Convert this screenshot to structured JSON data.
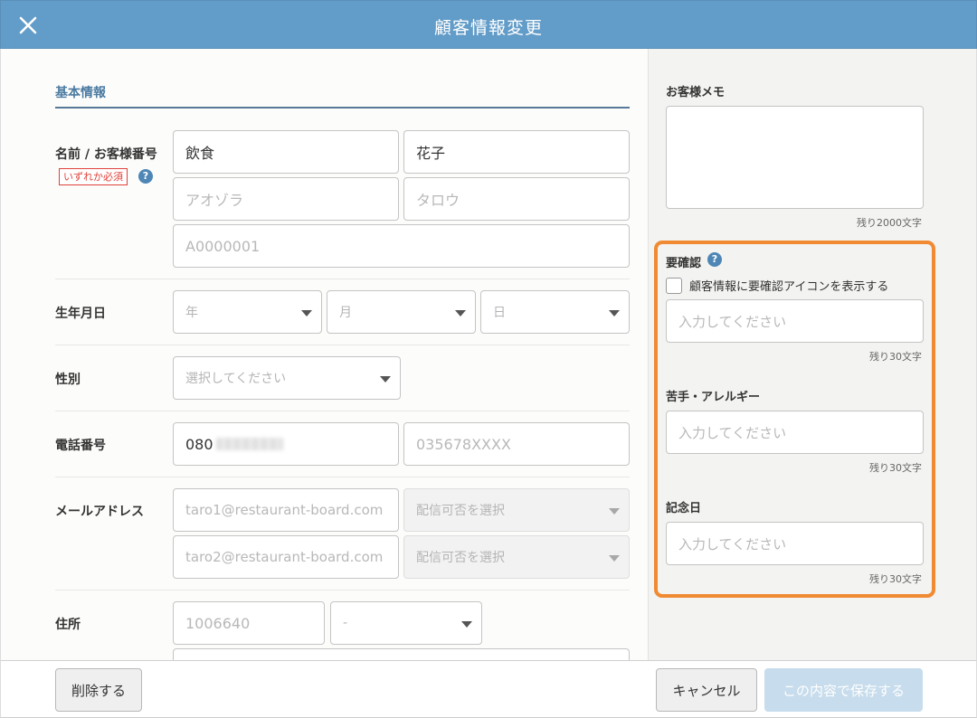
{
  "header": {
    "title": "顧客情報変更",
    "close_icon": "close-icon"
  },
  "basic": {
    "section_title": "基本情報",
    "name": {
      "label": "名前 / お客様番号",
      "required_badge": "いずれか必須",
      "help": "?",
      "last_name": "飲食",
      "first_name": "花子",
      "last_name_kana_placeholder": "アオゾラ",
      "first_name_kana_placeholder": "タロウ",
      "customer_number_placeholder": "A0000001"
    },
    "birthday": {
      "label": "生年月日",
      "year": "年",
      "month": "月",
      "day": "日"
    },
    "gender": {
      "label": "性別",
      "placeholder": "選択してください"
    },
    "phone": {
      "label": "電話番号",
      "phone1_prefix": "080",
      "phone2_placeholder": "035678XXXX"
    },
    "email": {
      "label": "メールアドレス",
      "email1_placeholder": "taro1@restaurant-board.com",
      "email2_placeholder": "taro2@restaurant-board.com",
      "delivery_placeholder": "配信可否を選択"
    },
    "address": {
      "label": "住所",
      "zip_placeholder": "1006640",
      "prefecture": "-"
    }
  },
  "side": {
    "memo": {
      "label": "お客様メモ",
      "counter": "残り2000文字"
    },
    "confirm": {
      "label": "要確認",
      "help": "?",
      "checkbox_label": "顧客情報に要確認アイコンを表示する",
      "placeholder": "入力してください",
      "counter": "残り30文字"
    },
    "allergy": {
      "label": "苦手・アレルギー",
      "placeholder": "入力してください",
      "counter": "残り30文字"
    },
    "anniversary": {
      "label": "記念日",
      "placeholder": "入力してください",
      "counter": "残り30文字"
    },
    "highlight_color": "#f08a33"
  },
  "footer": {
    "delete": "削除する",
    "cancel": "キャンセル",
    "save": "この内容で保存する"
  },
  "colors": {
    "header": "#629cc8",
    "accent": "#4c7ba2",
    "save_disabled": "#c7dcec"
  }
}
